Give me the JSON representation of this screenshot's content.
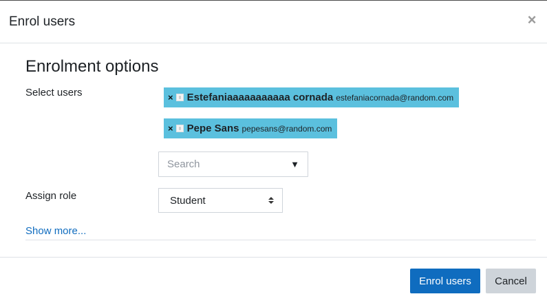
{
  "modal": {
    "title": "Enrol users",
    "close_symbol": "×"
  },
  "section": {
    "title": "Enrolment options"
  },
  "select_users": {
    "label": "Select users",
    "selected": [
      {
        "remove_symbol": "×",
        "name": "Estefaniaaaaaaaaaaa cornada",
        "email": "estefaniacornada@random.com"
      },
      {
        "remove_symbol": "×",
        "name": "Pepe Sans",
        "email": "pepesans@random.com"
      }
    ],
    "search_placeholder": "Search",
    "search_value": "",
    "dropdown_symbol": "▼"
  },
  "assign_role": {
    "label": "Assign role",
    "selected": "Student"
  },
  "show_more": "Show more...",
  "footer": {
    "primary_label": "Enrol users",
    "cancel_label": "Cancel"
  },
  "colors": {
    "chip_bg": "#5bc0de",
    "primary": "#0f6cbf",
    "secondary": "#ced4da",
    "link": "#0f6cbf"
  },
  "icons": {
    "close": "close-icon",
    "remove": "remove-icon",
    "user_picture": "user-picture-icon",
    "dropdown": "chevron-down-icon",
    "select_arrows": "sort-arrows-icon"
  }
}
